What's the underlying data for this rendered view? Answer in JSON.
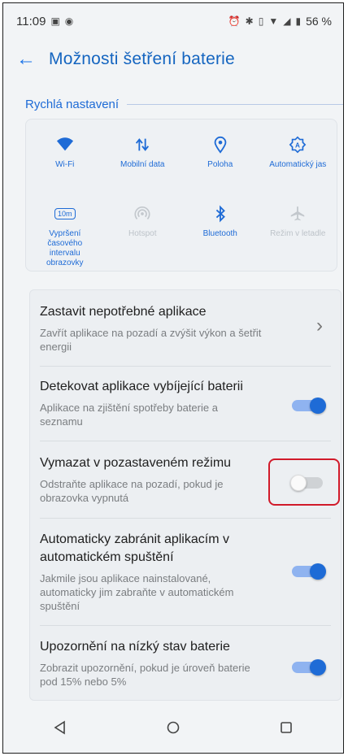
{
  "status_bar": {
    "time": "11:09",
    "battery": "56 %",
    "icons": [
      "screenshot-icon",
      "cast-icon",
      "alarm-icon",
      "bluetooth-icon",
      "vibrate-icon",
      "wifi-icon",
      "signal-icon",
      "battery-icon"
    ]
  },
  "app_bar": {
    "back": "←",
    "title": "Možnosti šetření baterie"
  },
  "quick_settings": {
    "header": "Rychlá nastavení",
    "items": [
      {
        "label": "Wi-Fi",
        "icon": "wifi-icon",
        "active": true
      },
      {
        "label": "Mobilní data",
        "icon": "mobile-data-icon",
        "active": true
      },
      {
        "label": "Poloha",
        "icon": "location-icon",
        "active": true
      },
      {
        "label": "Automatický jas",
        "icon": "auto-brightness-icon",
        "active": true
      },
      {
        "label": "Vypršení časového intervalu obrazovky",
        "icon": "screen-timeout-icon",
        "badge": "10m",
        "active": true
      },
      {
        "label": "Hotspot",
        "icon": "hotspot-icon",
        "active": false
      },
      {
        "label": "Bluetooth",
        "icon": "bluetooth-icon",
        "active": true
      },
      {
        "label": "Režim v letadle",
        "icon": "airplane-icon",
        "active": false
      }
    ]
  },
  "settings": [
    {
      "title": "Zastavit nepotřebné aplikace",
      "subtitle": "Zavřít aplikace na pozadí a zvýšit výkon a šetřit energii",
      "control": "chevron",
      "chevron": "›"
    },
    {
      "title": "Detekovat aplikace vybíjející baterii",
      "subtitle": "Aplikace na zjištění spotřeby baterie a seznamu",
      "control": "toggle",
      "on": true
    },
    {
      "title": "Vymazat v pozastaveném režimu",
      "subtitle": "Odstraňte aplikace na pozadí, pokud je obrazovka vypnutá",
      "control": "toggle",
      "on": false
    },
    {
      "title": "Automaticky zabránit aplikacím v automatickém spuštění",
      "subtitle": "Jakmile jsou aplikace nainstalované, automaticky jim zabraňte v automatickém spuštění",
      "control": "toggle",
      "on": true
    },
    {
      "title": "Upozornění na nízký stav baterie",
      "subtitle": "Zobrazit upozornění, pokud je úroveň baterie pod 15% nebo 5%",
      "control": "toggle",
      "on": true
    }
  ],
  "nav_bar": {
    "items": [
      "back-nav-icon",
      "home-icon",
      "recents-icon"
    ]
  },
  "colors": {
    "accent": "#1e6bd6",
    "highlight": "#d11a2a"
  }
}
